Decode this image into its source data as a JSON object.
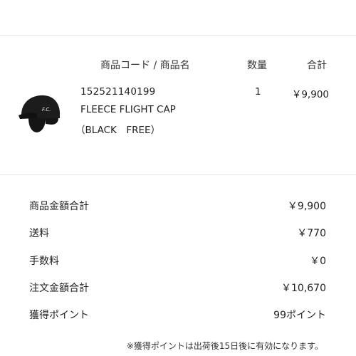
{
  "table": {
    "headers": {
      "product": "商品コード / 商品名",
      "quantity": "数量",
      "total": "合計"
    },
    "item": {
      "image_icon": "fleece-flight-cap-image",
      "code": "152521140199",
      "name": "FLEECE FLIGHT CAP",
      "variant": "（BLACK　FREE）",
      "quantity": "1",
      "price": "￥9,900"
    }
  },
  "summary": {
    "subtotal_label": "商品金額合計",
    "subtotal_value": "￥9,900",
    "shipping_label": "送料",
    "shipping_value": "￥770",
    "fee_label": "手数料",
    "fee_value": "￥0",
    "order_total_label": "注文金額合計",
    "order_total_value": "￥10,670",
    "points_label": "獲得ポイント",
    "points_value": "99ポイント"
  },
  "note": "※獲得ポイントは出荷後15日後に有効になります。",
  "colors": {
    "divider": "#e6e6e6",
    "text": "#222222",
    "cap": "#1a1a1a"
  }
}
